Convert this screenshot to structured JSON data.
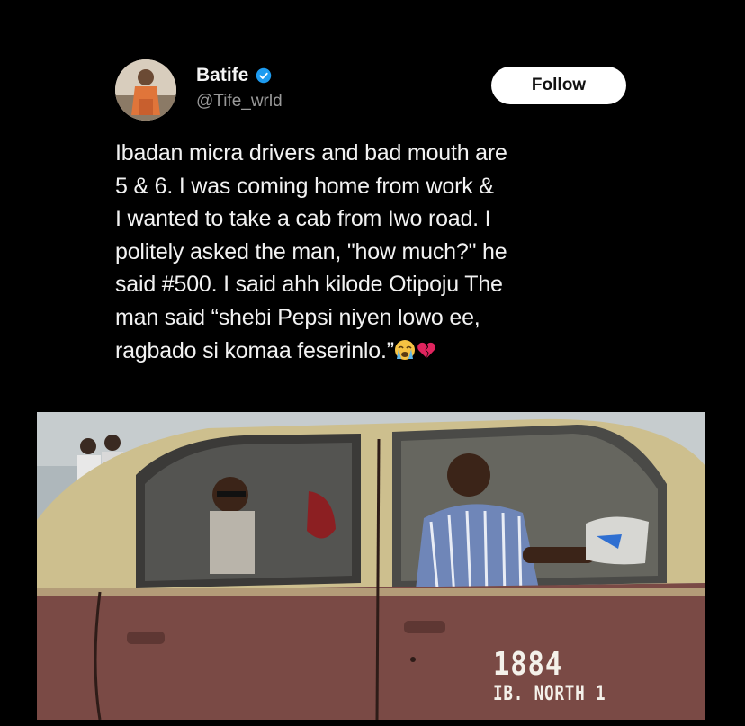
{
  "post": {
    "author": {
      "display_name": "Batife",
      "handle": "@Tife_wrld",
      "verified_icon": "verified-badge-icon",
      "avatar_icon": "avatar"
    },
    "follow_label": "Follow",
    "text": "Ibadan micra drivers and bad mouth are\n5 & 6. I was coming home from work &\nI wanted to take a cab from Iwo road. I\npolitely asked the man, \"how much?\" he\nsaid #500. I said ahh kilode Otipoju The\nman said “shebi Pepsi niyen lowo ee,\nragbado si komaa feserinlo.”",
    "emojis": [
      "loudly-crying-face-icon",
      "broken-heart-icon"
    ]
  },
  "photo": {
    "plate_number": "1884",
    "plate_region": "IB. NORTH 1"
  },
  "colors": {
    "background": "#000000",
    "text": "#f2f2f2",
    "handle": "#9a9a9a",
    "verified": "#1d9bf0",
    "follow_bg": "#ffffff",
    "taxi_top": "#cdbf8e",
    "taxi_body": "#7a4a45"
  }
}
